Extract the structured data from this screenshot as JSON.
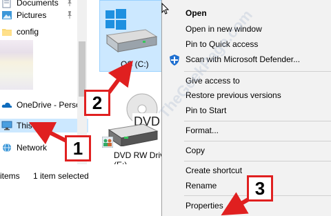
{
  "nav": {
    "items": [
      {
        "label": "Documents",
        "icon": "documents-icon",
        "pinned": true
      },
      {
        "label": "Pictures",
        "icon": "pictures-icon",
        "pinned": true
      },
      {
        "label": "config",
        "icon": "folder-icon",
        "pinned": false
      },
      {
        "label": "OneDrive - Persor",
        "icon": "onedrive-icon",
        "pinned": false
      },
      {
        "label": "This PC",
        "icon": "computer-icon",
        "selected": true
      },
      {
        "label": "Network",
        "icon": "network-icon",
        "pinned": false
      }
    ]
  },
  "main": {
    "drive_c_label": "OS (C:)",
    "dvd_label_line1": "DVD RW Drive",
    "dvd_label_line2": "(E:)",
    "dvd_disc_text": "DVD"
  },
  "status": {
    "items_text": "items",
    "selected_text": "1 item selected"
  },
  "context_menu": {
    "items": [
      "Open",
      "Open in new window",
      "Pin to Quick access",
      "Scan with Microsoft Defender...",
      "Give access to",
      "Restore previous versions",
      "Pin to Start",
      "Format...",
      "Copy",
      "Create shortcut",
      "Rename",
      "Properties"
    ]
  },
  "annotations": {
    "step1": "1",
    "step2": "2",
    "step3": "3",
    "arrow_color": "#e02020"
  },
  "watermark": "TheGeekPage.com"
}
